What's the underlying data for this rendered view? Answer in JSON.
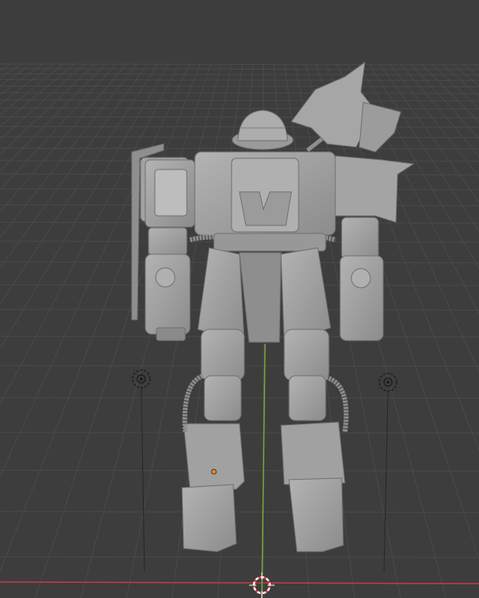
{
  "viewport": {
    "background": "#3d3d3d",
    "grid_color": "#4a4a4a",
    "x_axis_color": "#c33b45",
    "y_axis_color": "#76a93a",
    "model_color": "#a3a3a3",
    "origin_color": "#f08a1c"
  },
  "objects": [
    {
      "name": "robot-mesh",
      "type": "mesh"
    },
    {
      "name": "light-left",
      "type": "light",
      "icon": "point-light-icon"
    },
    {
      "name": "light-right",
      "type": "light",
      "icon": "point-light-icon"
    },
    {
      "name": "3d-cursor",
      "type": "cursor",
      "icon": "cursor-crosshair-icon"
    }
  ]
}
